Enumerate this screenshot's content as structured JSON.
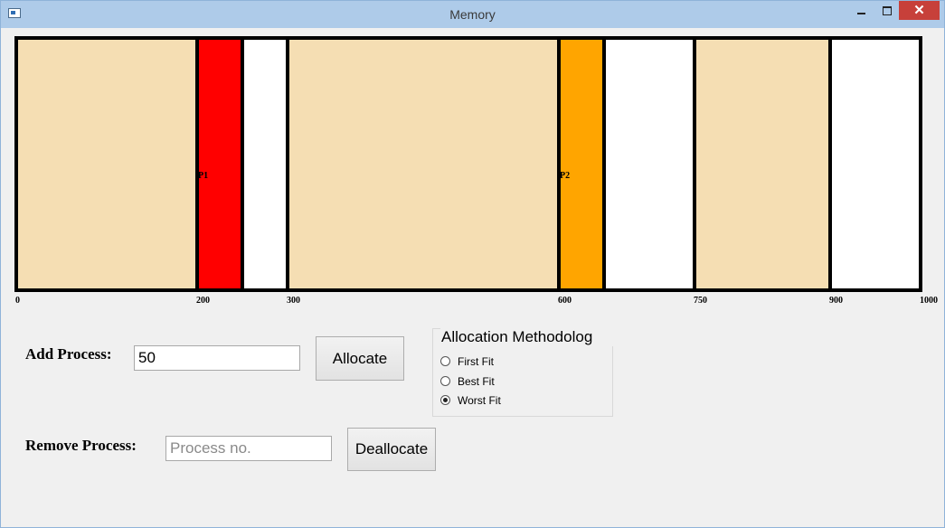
{
  "window": {
    "title": "Memory",
    "minimize_glyph": "minimize",
    "maximize_glyph": "maximize",
    "close_glyph": "✕"
  },
  "memory": {
    "total": 1000,
    "segments": [
      {
        "start": 0,
        "end": 200,
        "kind": "hole",
        "label": "",
        "color": "#f5deb3"
      },
      {
        "start": 200,
        "end": 250,
        "kind": "process",
        "label": "P1",
        "color": "#ff0000"
      },
      {
        "start": 250,
        "end": 300,
        "kind": "free",
        "label": "",
        "color": "#ffffff"
      },
      {
        "start": 300,
        "end": 600,
        "kind": "hole",
        "label": "",
        "color": "#f5deb3"
      },
      {
        "start": 600,
        "end": 650,
        "kind": "process",
        "label": "P2",
        "color": "#ffa500"
      },
      {
        "start": 650,
        "end": 750,
        "kind": "free",
        "label": "",
        "color": "#ffffff"
      },
      {
        "start": 750,
        "end": 900,
        "kind": "hole",
        "label": "",
        "color": "#f5deb3"
      },
      {
        "start": 900,
        "end": 1000,
        "kind": "free",
        "label": "",
        "color": "#ffffff"
      }
    ],
    "boundaries": [
      0,
      200,
      250,
      300,
      600,
      650,
      750,
      900,
      1000
    ],
    "ticks": [
      "0",
      "200",
      "300",
      "600",
      "750",
      "900",
      "1000"
    ]
  },
  "add_process": {
    "label": "Add Process:",
    "value": "50",
    "button": "Allocate"
  },
  "remove_process": {
    "label": "Remove Process:",
    "placeholder": "Process no.",
    "value": "",
    "button": "Deallocate"
  },
  "allocation": {
    "title": "Allocation Methodolog",
    "options": [
      "First Fit",
      "Best Fit",
      "Worst Fit"
    ],
    "selected": "Worst Fit"
  }
}
